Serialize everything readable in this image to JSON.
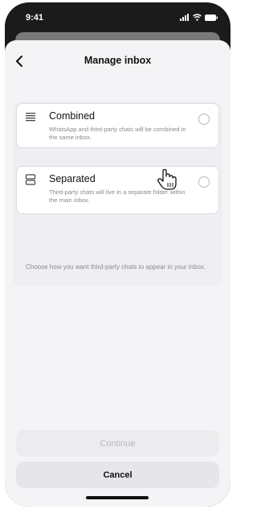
{
  "status_bar": {
    "time": "9:41"
  },
  "header": {
    "title": "Manage inbox"
  },
  "options": [
    {
      "title": "Combined",
      "description": "WhatsApp and third-party chats will be combined in the same inbox."
    },
    {
      "title": "Separated",
      "description": "Third-party chats will live in a separate folder within the main inbox."
    }
  ],
  "helper_text": "Choose how you want third-party chats to appear in your inbox.",
  "buttons": {
    "continue": "Continue",
    "cancel": "Cancel"
  },
  "colors": {
    "sheet_bg": "#f4f4f6",
    "disabled_text": "#b8b8bc"
  }
}
